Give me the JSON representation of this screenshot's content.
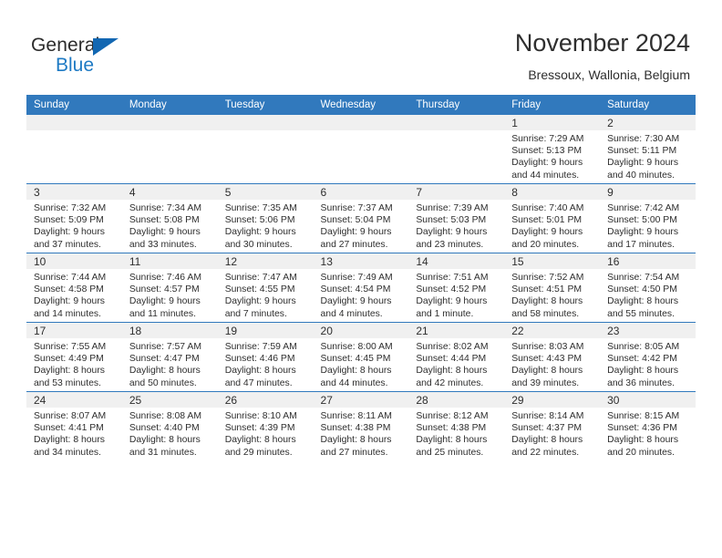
{
  "logo": {
    "word1": "General",
    "word2": "Blue",
    "triangle_color": "#1267b2",
    "blue_color": "#1e7ac4"
  },
  "header": {
    "title": "November 2024",
    "subtitle": "Bressoux, Wallonia, Belgium"
  },
  "theme": {
    "header_bar": "#3179bd",
    "num_band": "#f0f0f0",
    "text": "#2e2e2e"
  },
  "weekdays": [
    "Sunday",
    "Monday",
    "Tuesday",
    "Wednesday",
    "Thursday",
    "Friday",
    "Saturday"
  ],
  "weeks": [
    [
      {
        "day": "",
        "lines": []
      },
      {
        "day": "",
        "lines": []
      },
      {
        "day": "",
        "lines": []
      },
      {
        "day": "",
        "lines": []
      },
      {
        "day": "",
        "lines": []
      },
      {
        "day": "1",
        "lines": [
          "Sunrise: 7:29 AM",
          "Sunset: 5:13 PM",
          "Daylight: 9 hours",
          "and 44 minutes."
        ]
      },
      {
        "day": "2",
        "lines": [
          "Sunrise: 7:30 AM",
          "Sunset: 5:11 PM",
          "Daylight: 9 hours",
          "and 40 minutes."
        ]
      }
    ],
    [
      {
        "day": "3",
        "lines": [
          "Sunrise: 7:32 AM",
          "Sunset: 5:09 PM",
          "Daylight: 9 hours",
          "and 37 minutes."
        ]
      },
      {
        "day": "4",
        "lines": [
          "Sunrise: 7:34 AM",
          "Sunset: 5:08 PM",
          "Daylight: 9 hours",
          "and 33 minutes."
        ]
      },
      {
        "day": "5",
        "lines": [
          "Sunrise: 7:35 AM",
          "Sunset: 5:06 PM",
          "Daylight: 9 hours",
          "and 30 minutes."
        ]
      },
      {
        "day": "6",
        "lines": [
          "Sunrise: 7:37 AM",
          "Sunset: 5:04 PM",
          "Daylight: 9 hours",
          "and 27 minutes."
        ]
      },
      {
        "day": "7",
        "lines": [
          "Sunrise: 7:39 AM",
          "Sunset: 5:03 PM",
          "Daylight: 9 hours",
          "and 23 minutes."
        ]
      },
      {
        "day": "8",
        "lines": [
          "Sunrise: 7:40 AM",
          "Sunset: 5:01 PM",
          "Daylight: 9 hours",
          "and 20 minutes."
        ]
      },
      {
        "day": "9",
        "lines": [
          "Sunrise: 7:42 AM",
          "Sunset: 5:00 PM",
          "Daylight: 9 hours",
          "and 17 minutes."
        ]
      }
    ],
    [
      {
        "day": "10",
        "lines": [
          "Sunrise: 7:44 AM",
          "Sunset: 4:58 PM",
          "Daylight: 9 hours",
          "and 14 minutes."
        ]
      },
      {
        "day": "11",
        "lines": [
          "Sunrise: 7:46 AM",
          "Sunset: 4:57 PM",
          "Daylight: 9 hours",
          "and 11 minutes."
        ]
      },
      {
        "day": "12",
        "lines": [
          "Sunrise: 7:47 AM",
          "Sunset: 4:55 PM",
          "Daylight: 9 hours",
          "and 7 minutes."
        ]
      },
      {
        "day": "13",
        "lines": [
          "Sunrise: 7:49 AM",
          "Sunset: 4:54 PM",
          "Daylight: 9 hours",
          "and 4 minutes."
        ]
      },
      {
        "day": "14",
        "lines": [
          "Sunrise: 7:51 AM",
          "Sunset: 4:52 PM",
          "Daylight: 9 hours",
          "and 1 minute."
        ]
      },
      {
        "day": "15",
        "lines": [
          "Sunrise: 7:52 AM",
          "Sunset: 4:51 PM",
          "Daylight: 8 hours",
          "and 58 minutes."
        ]
      },
      {
        "day": "16",
        "lines": [
          "Sunrise: 7:54 AM",
          "Sunset: 4:50 PM",
          "Daylight: 8 hours",
          "and 55 minutes."
        ]
      }
    ],
    [
      {
        "day": "17",
        "lines": [
          "Sunrise: 7:55 AM",
          "Sunset: 4:49 PM",
          "Daylight: 8 hours",
          "and 53 minutes."
        ]
      },
      {
        "day": "18",
        "lines": [
          "Sunrise: 7:57 AM",
          "Sunset: 4:47 PM",
          "Daylight: 8 hours",
          "and 50 minutes."
        ]
      },
      {
        "day": "19",
        "lines": [
          "Sunrise: 7:59 AM",
          "Sunset: 4:46 PM",
          "Daylight: 8 hours",
          "and 47 minutes."
        ]
      },
      {
        "day": "20",
        "lines": [
          "Sunrise: 8:00 AM",
          "Sunset: 4:45 PM",
          "Daylight: 8 hours",
          "and 44 minutes."
        ]
      },
      {
        "day": "21",
        "lines": [
          "Sunrise: 8:02 AM",
          "Sunset: 4:44 PM",
          "Daylight: 8 hours",
          "and 42 minutes."
        ]
      },
      {
        "day": "22",
        "lines": [
          "Sunrise: 8:03 AM",
          "Sunset: 4:43 PM",
          "Daylight: 8 hours",
          "and 39 minutes."
        ]
      },
      {
        "day": "23",
        "lines": [
          "Sunrise: 8:05 AM",
          "Sunset: 4:42 PM",
          "Daylight: 8 hours",
          "and 36 minutes."
        ]
      }
    ],
    [
      {
        "day": "24",
        "lines": [
          "Sunrise: 8:07 AM",
          "Sunset: 4:41 PM",
          "Daylight: 8 hours",
          "and 34 minutes."
        ]
      },
      {
        "day": "25",
        "lines": [
          "Sunrise: 8:08 AM",
          "Sunset: 4:40 PM",
          "Daylight: 8 hours",
          "and 31 minutes."
        ]
      },
      {
        "day": "26",
        "lines": [
          "Sunrise: 8:10 AM",
          "Sunset: 4:39 PM",
          "Daylight: 8 hours",
          "and 29 minutes."
        ]
      },
      {
        "day": "27",
        "lines": [
          "Sunrise: 8:11 AM",
          "Sunset: 4:38 PM",
          "Daylight: 8 hours",
          "and 27 minutes."
        ]
      },
      {
        "day": "28",
        "lines": [
          "Sunrise: 8:12 AM",
          "Sunset: 4:38 PM",
          "Daylight: 8 hours",
          "and 25 minutes."
        ]
      },
      {
        "day": "29",
        "lines": [
          "Sunrise: 8:14 AM",
          "Sunset: 4:37 PM",
          "Daylight: 8 hours",
          "and 22 minutes."
        ]
      },
      {
        "day": "30",
        "lines": [
          "Sunrise: 8:15 AM",
          "Sunset: 4:36 PM",
          "Daylight: 8 hours",
          "and 20 minutes."
        ]
      }
    ]
  ]
}
